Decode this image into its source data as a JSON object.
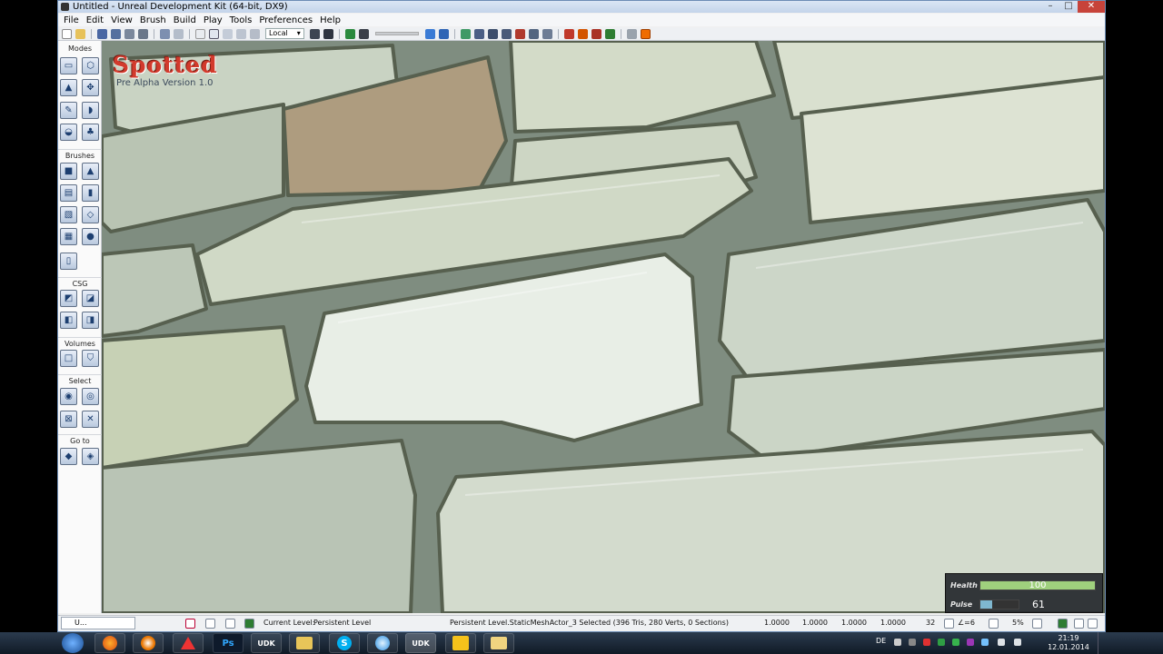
{
  "window": {
    "title": "Untitled - Unreal Development Kit (64-bit, DX9)",
    "controls": {
      "minimize": "–",
      "maximize": "□",
      "close": "✕"
    }
  },
  "menu": [
    "File",
    "Edit",
    "View",
    "Brush",
    "Build",
    "Play",
    "Tools",
    "Preferences",
    "Help"
  ],
  "toolbar": {
    "coord_system": "Local"
  },
  "modes_panel": {
    "title": "Modes",
    "sections": [
      "Brushes",
      "CSG",
      "Volumes",
      "Select",
      "Go to"
    ]
  },
  "viewport": {
    "game_logo": {
      "title": "Spotted",
      "version": "Pre Alpha Version 1.0"
    },
    "hud": {
      "health_label": "Health",
      "health_value": "100",
      "health_fraction": 1.0,
      "pulse_label": "Pulse",
      "pulse_value": "61",
      "pulse_fraction": 0.3
    }
  },
  "status_bar": {
    "doc_tab": "U...",
    "current_level_label": "Current Level:",
    "current_level_value": "Persistent Level",
    "selection_info": "Persistent Level.StaticMeshActor_3 Selected (396 Tris, 280 Verts, 0 Sections)",
    "drag_grid": [
      "1.0000",
      "1.0000",
      "1.0000",
      "1.0000"
    ],
    "grid_size": "32",
    "rotation_snap": "∠=6",
    "scale_snap": "5%"
  },
  "taskbar": {
    "apps": [
      "firefox",
      "blender",
      "inkscape",
      "photoshop",
      "udk",
      "explorer",
      "skype",
      "itunes",
      "udk-editor",
      "99designs",
      "folder"
    ],
    "photoshop_label": "Ps",
    "udk_label": "UDK",
    "language": "DE",
    "time": "21:19",
    "date": "12.01.2014"
  },
  "colors": {
    "health_bar": "#9fd07d",
    "pulse_bar": "#7fb7cf",
    "logo": "#d23a2c",
    "title_bar": "#c3d4ea",
    "taskbar": "#1b2838"
  }
}
